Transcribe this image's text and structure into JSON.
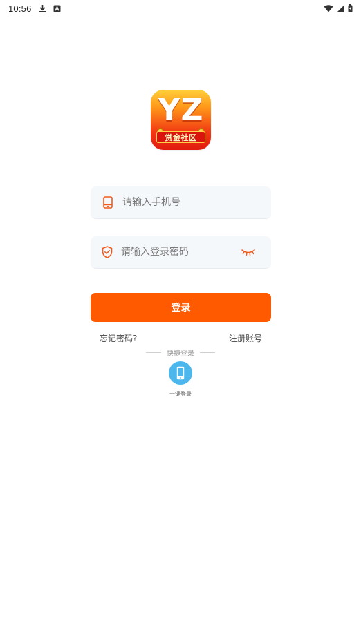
{
  "status_bar": {
    "time": "10:56",
    "icons": [
      "download-icon",
      "a-notification-icon",
      "wifi-icon",
      "cellular-signal-icon",
      "battery-icon"
    ]
  },
  "logo": {
    "main_text": "YZ",
    "sub_text": "赏金社区"
  },
  "form": {
    "phone": {
      "placeholder": "请输入手机号",
      "value": "",
      "icon": "phone-icon"
    },
    "password": {
      "placeholder": "请输入登录密码",
      "value": "",
      "icon": "shield-check-icon",
      "toggle_icon": "eye-closed-icon"
    },
    "login_label": "登录",
    "forgot_label": "忘记密码?",
    "register_label": "注册账号"
  },
  "quick_login": {
    "divider_label": "快捷登录",
    "onekey_label": "一键登录",
    "onekey_icon": "phone-icon"
  },
  "colors": {
    "accent": "#ff5a00",
    "input_bg": "#f4f8fb",
    "quick_btn": "#4bb7ec",
    "icon_orange": "#f05a1c"
  }
}
